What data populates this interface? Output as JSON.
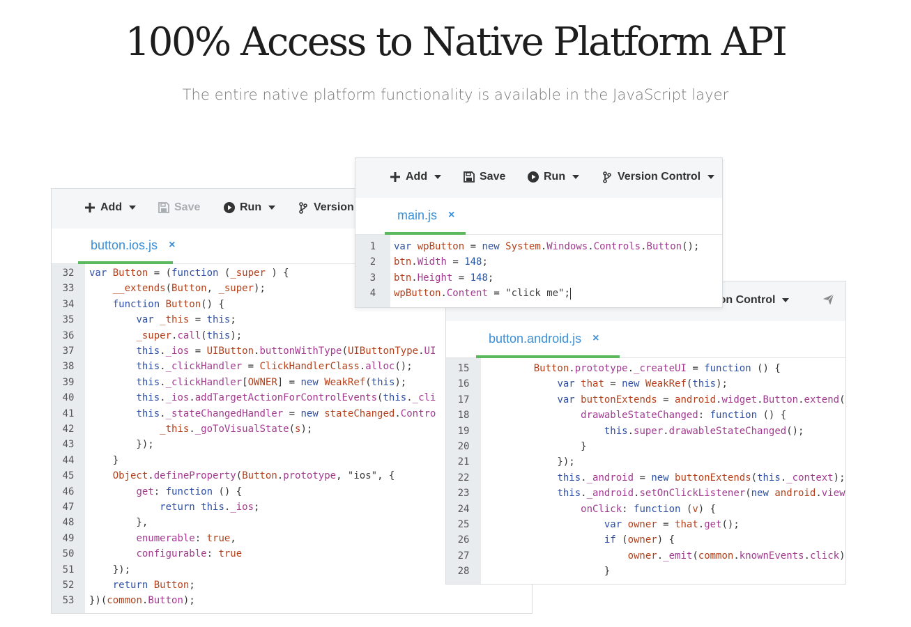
{
  "headline": "100% Access to Native Platform API",
  "subheadline": "The entire native platform functionality is available in the JavaScript layer",
  "toolbar": {
    "add": "Add",
    "save": "Save",
    "run": "Run",
    "version_control": "Version Control",
    "version_truncated": "Version",
    "version_tail": "rsion Control"
  },
  "ios_editor": {
    "tab": "button.ios.js",
    "close": "×",
    "lines": [
      {
        "n": "32",
        "code": [
          [
            "k",
            "var"
          ],
          [
            "",
            "  "
          ],
          [
            "r",
            "Button"
          ],
          [
            "",
            " = ("
          ],
          [
            "k",
            "function"
          ],
          [
            "",
            " ("
          ],
          [
            "r",
            "_super"
          ],
          [
            "",
            " ) {"
          ]
        ]
      }
    ]
  },
  "main_editor": {
    "tab": "main.js",
    "close": "×",
    "lines": [
      {
        "n": "1",
        "code": [
          [
            "k",
            "var "
          ],
          [
            "r",
            "wpButton"
          ],
          [
            "",
            " = "
          ],
          [
            "k",
            "new "
          ],
          [
            "r",
            "System"
          ],
          [
            "",
            "."
          ],
          [
            "p",
            "Windows"
          ],
          [
            "",
            "."
          ],
          [
            "p",
            "Controls"
          ],
          [
            "",
            "."
          ],
          [
            "p",
            "Button"
          ],
          [
            "",
            "();"
          ]
        ]
      },
      {
        "n": "2",
        "code": [
          [
            "r",
            "btn"
          ],
          [
            "",
            "."
          ],
          [
            "p",
            "Width"
          ],
          [
            "",
            " = "
          ],
          [
            "n",
            "148"
          ],
          [
            "",
            ";"
          ]
        ]
      },
      {
        "n": "3",
        "code": [
          [
            "r",
            "btn"
          ],
          [
            "",
            "."
          ],
          [
            "p",
            "Height"
          ],
          [
            "",
            " = "
          ],
          [
            "n",
            "148"
          ],
          [
            "",
            ";"
          ]
        ]
      },
      {
        "n": "4",
        "code": [
          [
            "r",
            "wpButton"
          ],
          [
            "",
            "."
          ],
          [
            "p",
            "Content"
          ],
          [
            "",
            " = "
          ],
          [
            "s",
            "\"click me\""
          ],
          [
            "",
            ";"
          ]
        ]
      }
    ]
  },
  "android_editor": {
    "tab": "button.android.js",
    "close": "×",
    "lines": []
  },
  "colors": {
    "accent_tab": "#5cb85c",
    "tab_text": "#3b8fd6",
    "keyword": "#2e4fa3",
    "identifier": "#b3401a",
    "property": "#a23a8f"
  }
}
